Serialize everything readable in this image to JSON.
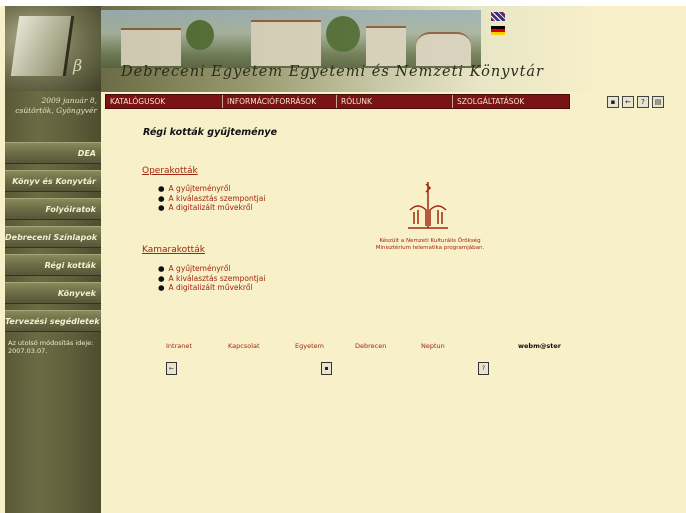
{
  "header": {
    "title": "Debreceni Egyetem Egyetemi és Nemzeti Könyvtár",
    "flags": [
      "uk-flag-icon",
      "germany-flag-icon"
    ]
  },
  "sidebar": {
    "date": "2009 január 8, csütörtök, Gyöngyvér",
    "items": [
      {
        "label": "DEA"
      },
      {
        "label": "Könyv és Konyvtár"
      },
      {
        "label": "Folyóiratok"
      },
      {
        "label": "Debreceni Színlapok"
      },
      {
        "label": "Régi kották"
      },
      {
        "label": "Könyvek"
      },
      {
        "label": "Tervezési segédletek"
      }
    ],
    "updated": "Az utolsó módosítás ideje: 2007.03.07."
  },
  "topmenu": {
    "items": [
      {
        "label": "KATALÓGUSOK"
      },
      {
        "label": "INFORMÁCIÓFORRÁSOK"
      },
      {
        "label": "RÓLUNK"
      },
      {
        "label": "SZOLGÁLTATÁSOK"
      }
    ],
    "icons": [
      "lock-icon",
      "back-icon",
      "help-icon",
      "print-icon"
    ]
  },
  "main": {
    "page_title": "Régi kották gyűjteménye",
    "sections": [
      {
        "title": "Operakották",
        "links": [
          "A gyűjteményről",
          "A kiválasztás szempontjai",
          "A digitalizált művekről"
        ]
      },
      {
        "title": "Kamarakották",
        "links": [
          "A gyűjteményről",
          "A kiválasztás szempontjai",
          "A digitalizált művekről"
        ]
      }
    ],
    "credit_line1": "Készült a Nemzeti Kulturális Örökség",
    "credit_line2": "Minisztérium telematika programjában."
  },
  "footer": {
    "links": [
      "Intranet",
      "Kapcsolat",
      "Egyetem",
      "Debrecen",
      "Neptun"
    ],
    "email": "webm@ster"
  },
  "colors": {
    "accent": "#a02810",
    "menu_bg": "#7a1414",
    "page_bg": "#f8f0c8",
    "sidebar_bg": "#5e5e3b"
  }
}
